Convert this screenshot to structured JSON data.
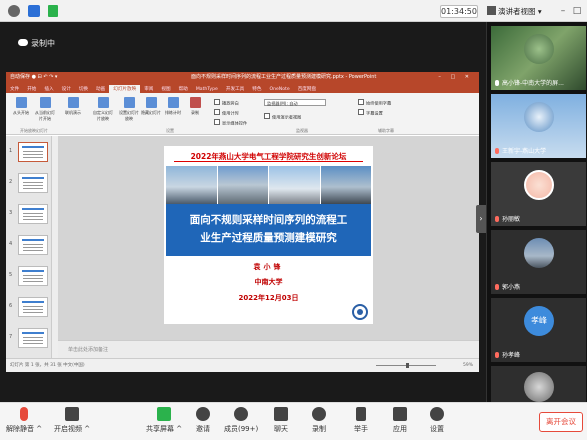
{
  "topbar": {
    "timer": "01:34:50",
    "view_mode": "演讲者视图"
  },
  "recording": {
    "label": "录制中"
  },
  "ppt": {
    "window_title": "面向不规则采样时间序列的流程工业生产过程质量预测建模研究.pptx - PowerPoint",
    "tabs": [
      "文件",
      "开始",
      "插入",
      "设计",
      "切换",
      "动画",
      "幻灯片放映",
      "审阅",
      "视图",
      "帮助",
      "MathType",
      "开发工具",
      "特色",
      "OneNote",
      "百度网盘"
    ],
    "active_tab": "幻灯片放映",
    "notes_placeholder": "单击此处添加备注",
    "status_left": "幻灯片 第 1 张，共 31 张   中文(中国)",
    "zoom": "59%",
    "ribbon": {
      "buttons": [
        "从头开始",
        "从当前幻灯片开始",
        "联机演示",
        "自定义幻灯片放映",
        "设置幻灯片放映",
        "隐藏幻灯片",
        "排练计时",
        "录制"
      ],
      "checks": [
        "播放旁白",
        "使用计时",
        "显示媒体控件",
        "使用演示者视图",
        "始终使用字幕",
        "字幕设置"
      ],
      "monitor_label": "监视器(M):",
      "monitor_value": "自动",
      "groups": [
        "开始放映幻灯片",
        "设置",
        "监视器",
        "辅助字幕"
      ]
    },
    "thumb_numbers": [
      "1",
      "2",
      "3",
      "4",
      "5",
      "6",
      "7"
    ]
  },
  "slide": {
    "header": "2022年燕山大学电气工程学院研究生创新论坛",
    "title_line1": "面向不规则采样时间序列的流程工",
    "title_line2": "业生产过程质量预测建模研究",
    "author": "袁小锋",
    "university": "中南大学",
    "date": "2022年12月03日"
  },
  "participants": [
    {
      "name": "高小锋-中南大学的屏...",
      "muted": false
    },
    {
      "name": "王新宇-燕山大学",
      "muted": true
    },
    {
      "name": "孙丽敏",
      "muted": true
    },
    {
      "name": "郭小燕",
      "muted": true
    },
    {
      "name": "孙孝峰",
      "muted": true,
      "avatar_text": "孝峰"
    },
    {
      "name": "",
      "muted": true
    }
  ],
  "bottom_bar": {
    "unmute": "解除静音",
    "video": "开启视频",
    "share": "共享屏幕",
    "invite": "邀请",
    "members": "成员(99+)",
    "chat": "聊天",
    "record": "录制",
    "raise_hand": "举手",
    "apps": "应用",
    "settings": "设置",
    "leave": "离开会议"
  },
  "colors": {
    "ppt_red": "#b7472a",
    "slide_blue": "#1f66b8",
    "slide_red": "#c00000",
    "leave_red": "#e64a3b"
  }
}
